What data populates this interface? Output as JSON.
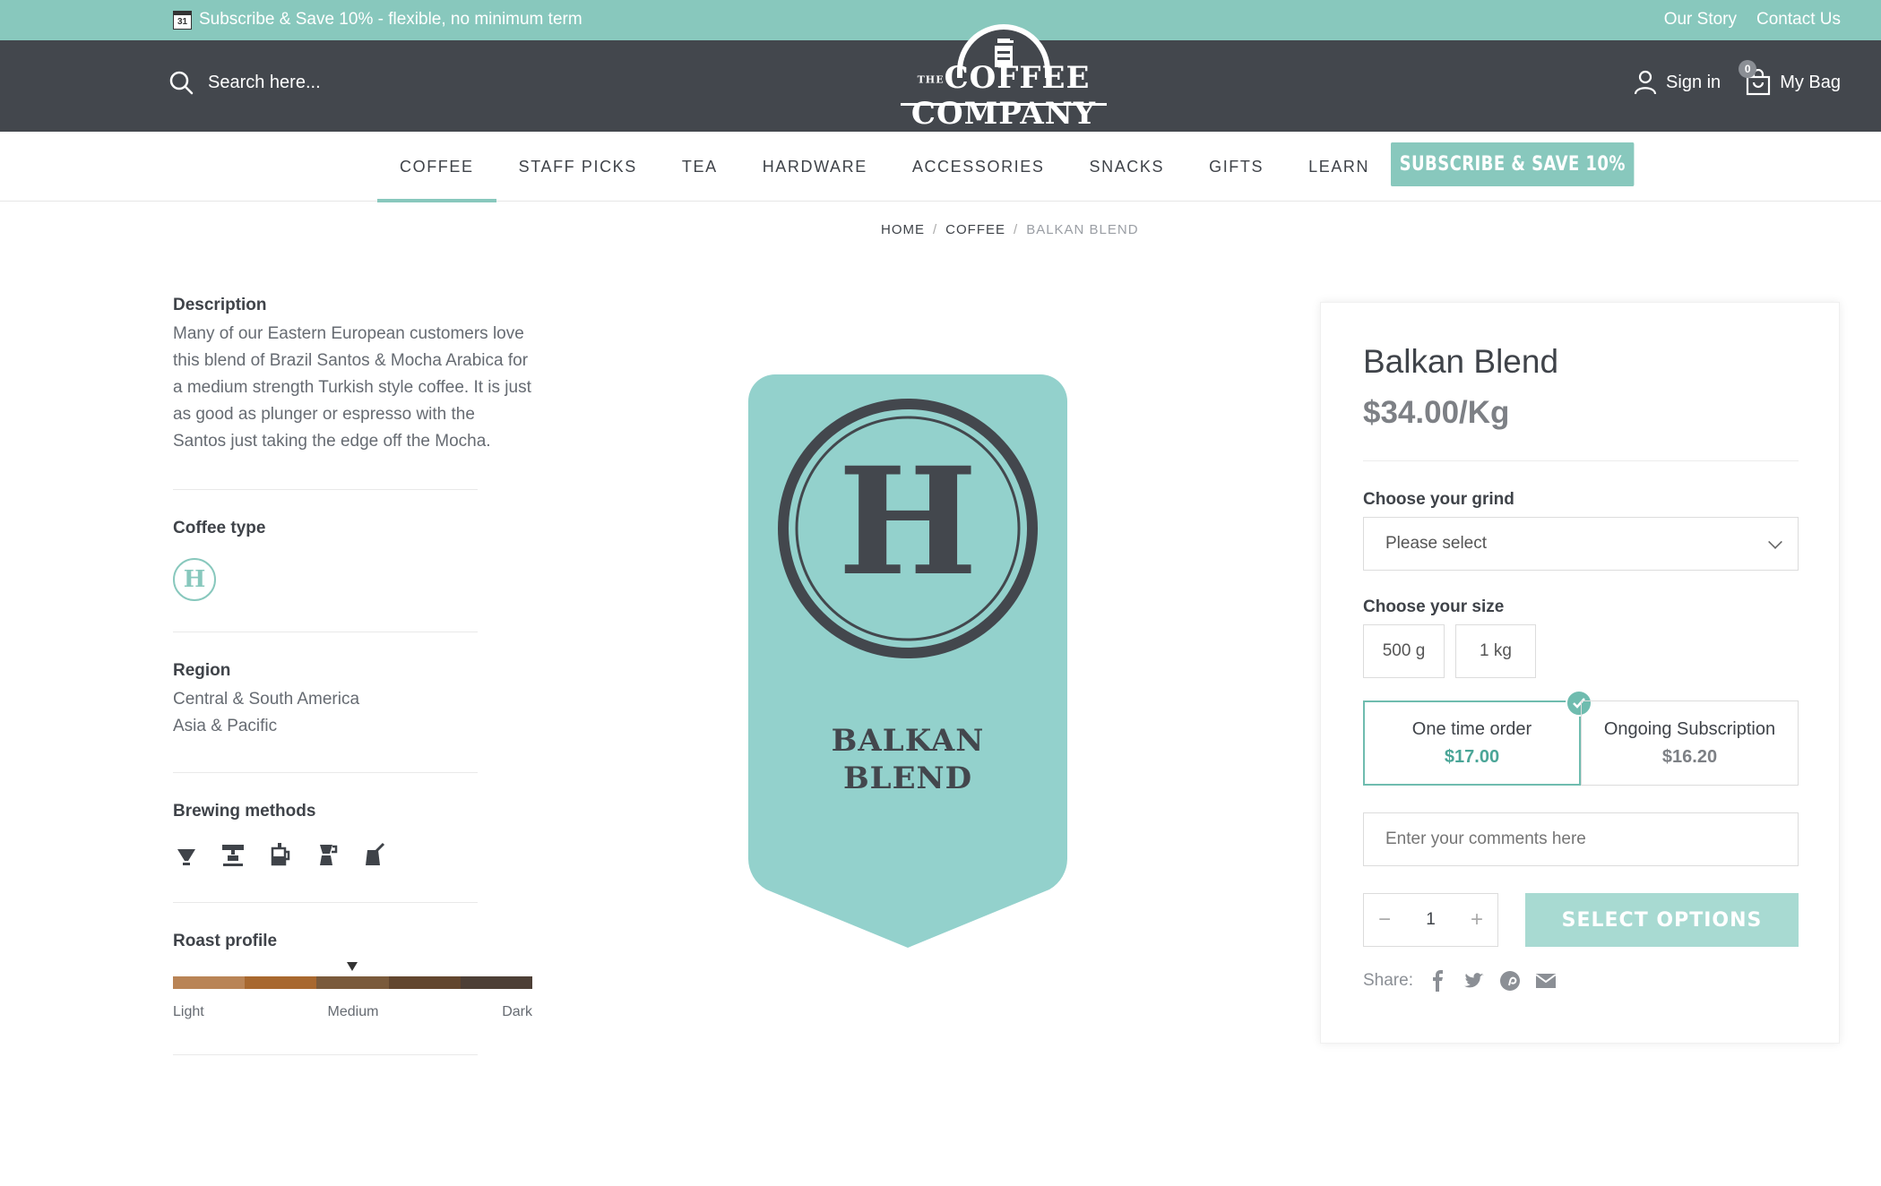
{
  "topbar": {
    "calendar_day": "31",
    "promo_text": "Subscribe & Save 10% - flexible, no minimum term",
    "links": [
      "Our Story",
      "Contact Us"
    ]
  },
  "header": {
    "search_placeholder": "Search here...",
    "logo": {
      "the": "THE",
      "name": "COFFEE COMPANY"
    },
    "sign_in": "Sign in",
    "bag_label": "My Bag",
    "bag_count": "0"
  },
  "nav": {
    "items": [
      "COFFEE",
      "STAFF PICKS",
      "TEA",
      "HARDWARE",
      "ACCESSORIES",
      "SNACKS",
      "GIFTS",
      "LEARN"
    ],
    "active": "COFFEE",
    "cta": "SUBSCRIBE & SAVE 10%"
  },
  "breadcrumb": {
    "items": [
      "HOME",
      "COFFEE",
      "BALKAN BLEND"
    ],
    "separator": "/"
  },
  "details": {
    "description_title": "Description",
    "description": "Many of our Eastern European customers love this blend of Brazil Santos & Mocha Arabica for a medium strength Turkish style coffee. It is just as good as plunger or espresso with the Santos just taking the edge off the Mocha.",
    "coffee_type_title": "Coffee type",
    "coffee_type_letter": "H",
    "region_title": "Region",
    "regions": [
      "Central & South America",
      "Asia & Pacific"
    ],
    "brewing_title": "Brewing methods",
    "brewing_icons": [
      "pour-over-icon",
      "espresso-machine-icon",
      "plunger-icon",
      "moka-pot-icon",
      "turkish-pot-icon"
    ],
    "roast_title": "Roast profile",
    "roast_labels": [
      "Light",
      "Medium",
      "Dark"
    ],
    "roast_colors": [
      "#b98456",
      "#a8682f",
      "#7a5a3b",
      "#62462e",
      "#4d3f36"
    ],
    "roast_level": "Medium"
  },
  "product_image": {
    "letter": "H",
    "name_line1": "BALKAN",
    "name_line2": "BLEND",
    "color": "#93d1cc",
    "ink": "#43474d"
  },
  "product": {
    "title": "Balkan Blend",
    "price": "$34.00/Kg",
    "grind_label": "Choose your grind",
    "grind_value": "Please select",
    "size_label": "Choose your size",
    "sizes": [
      "500 g",
      "1 kg"
    ],
    "plans": [
      {
        "name": "One time order",
        "price": "$17.00",
        "selected": true
      },
      {
        "name": "Ongoing Subscription",
        "price": "$16.20",
        "selected": false
      }
    ],
    "comments_placeholder": "Enter your comments here",
    "quantity": "1",
    "minus": "−",
    "plus": "+",
    "cta": "SELECT OPTIONS",
    "share_label": "Share:",
    "share_icons": [
      "facebook-icon",
      "twitter-icon",
      "pinterest-icon",
      "email-icon"
    ]
  },
  "colors": {
    "accent": "#88c8bd",
    "header_bg": "#43474d",
    "text": "#3f4349"
  }
}
